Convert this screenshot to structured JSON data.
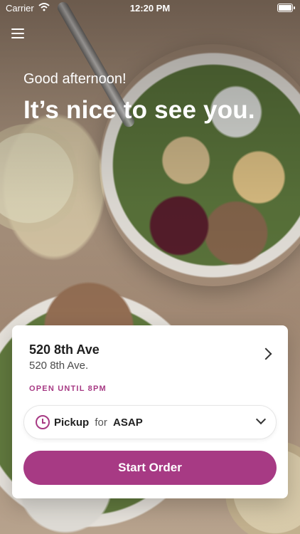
{
  "status_bar": {
    "carrier": "Carrier",
    "time": "12:20 PM"
  },
  "greeting": {
    "small": "Good afternoon!",
    "large": "It’s nice to see you."
  },
  "store": {
    "name": "520 8th Ave",
    "address": "520 8th Ave.",
    "open_status": "OPEN UNTIL 8PM"
  },
  "order": {
    "mode": "Pickup",
    "for_label": "for",
    "time": "ASAP"
  },
  "actions": {
    "start_order": "Start Order"
  },
  "colors": {
    "accent": "#a73a84"
  },
  "icons": {
    "menu": "hamburger-menu-icon",
    "chevron_right": "chevron-right-icon",
    "clock": "clock-icon",
    "chevron_down": "chevron-down-icon",
    "wifi": "wifi-icon",
    "battery": "battery-icon"
  }
}
